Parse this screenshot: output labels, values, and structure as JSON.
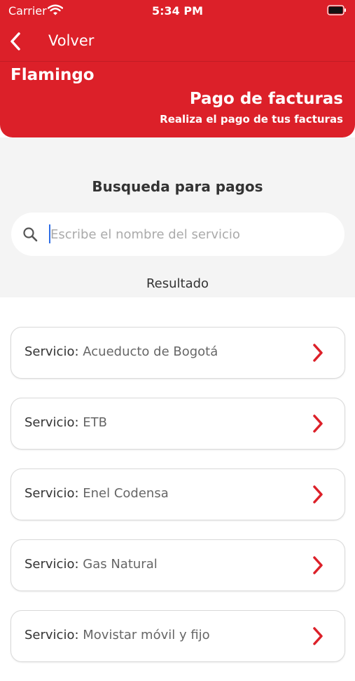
{
  "status_bar": {
    "carrier": "Carrier",
    "time": "5:34 PM"
  },
  "nav": {
    "back_label": "Volver"
  },
  "header": {
    "brand": "Flamingo",
    "title": "Pago de facturas",
    "subtitle": "Realiza el pago de tus facturas"
  },
  "search": {
    "heading": "Busqueda para pagos",
    "placeholder": "Escribe el nombre del servicio",
    "value": "",
    "results_label": "Resultado"
  },
  "services": {
    "prefix": "Servicio:",
    "items": [
      {
        "name": "Acueducto de Bogotá"
      },
      {
        "name": "ETB"
      },
      {
        "name": "Enel Codensa"
      },
      {
        "name": "Gas Natural"
      },
      {
        "name": "Movistar móvil y fijo"
      }
    ]
  },
  "colors": {
    "accent": "#dc2029",
    "background": "#f4f4f4",
    "card_border": "#d9d9d9"
  },
  "icons": [
    "wifi-icon",
    "battery-icon",
    "back-chevron-icon",
    "search-icon",
    "chevron-right-icon"
  ]
}
